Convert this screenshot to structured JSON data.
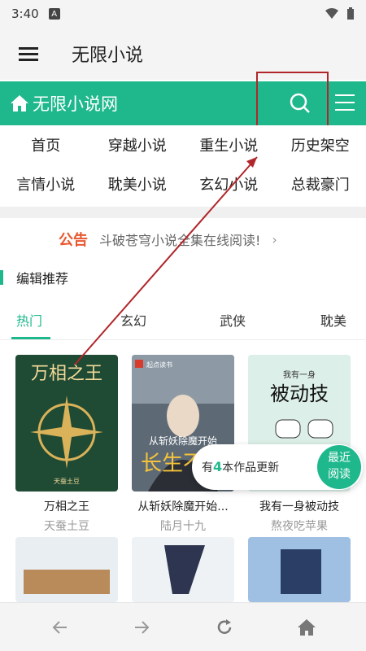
{
  "status": {
    "time": "3:40",
    "badge": "A"
  },
  "appbar": {
    "title": "无限小说"
  },
  "site": {
    "logo_text": "无限小说网"
  },
  "nav": {
    "row1": [
      "首页",
      "穿越小说",
      "重生小说",
      "历史架空"
    ],
    "row2": [
      "言情小说",
      "耽美小说",
      "玄幻小说",
      "总裁豪门"
    ]
  },
  "notice": {
    "tag": "公告",
    "text": "斗破苍穹小说全集在线阅读!"
  },
  "section": {
    "title": "编辑推荐"
  },
  "tabs": [
    "热门",
    "玄幻",
    "武侠",
    "耽美"
  ],
  "books": [
    {
      "name": "万相之王",
      "author": "天蚕土豆",
      "cover_title": "万相之王",
      "cover_author": "天蚕土豆"
    },
    {
      "name": "从斩妖除魔开始...",
      "author": "陆月十九",
      "cover_title": "从斩妖除魔开始",
      "cover_badge": "起点读书",
      "cover_big": "长生不"
    },
    {
      "name": "我有一身被动技",
      "author": "熬夜吃苹果",
      "cover_title": "被动技",
      "cover_top": "我有一身"
    }
  ],
  "update": {
    "prefix": "有",
    "count": "4",
    "suffix": "本作品更新",
    "recent_line1": "最近",
    "recent_line2": "阅读"
  },
  "colors": {
    "accent": "#1fb88d",
    "notice": "#e8582f",
    "highlight": "#b0262a"
  }
}
